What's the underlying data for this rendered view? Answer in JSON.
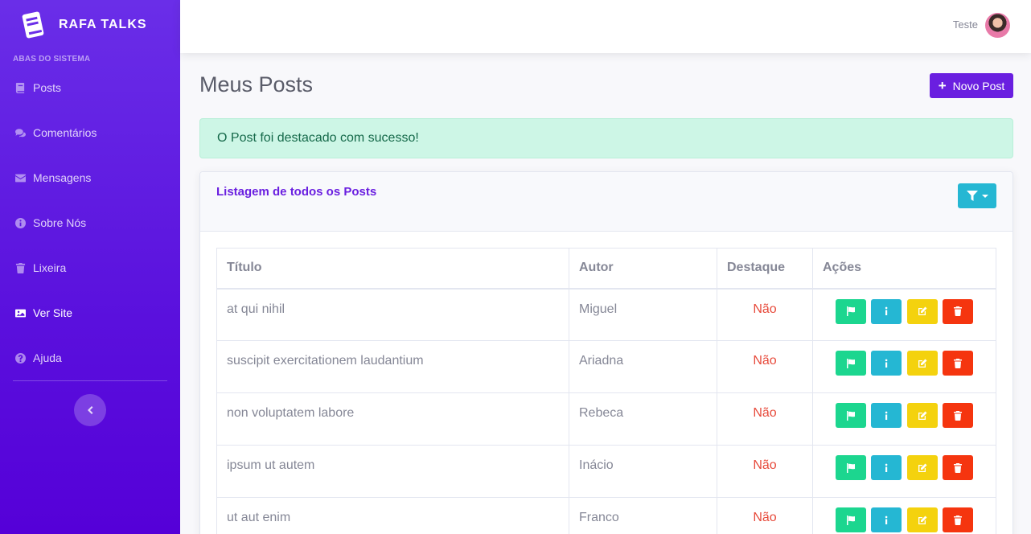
{
  "brand": {
    "name": "RAFA TALKS",
    "logo_icon": "book-logo-icon"
  },
  "sidebar": {
    "heading": "ABAS DO SISTEMA",
    "items": [
      {
        "label": "Posts",
        "icon": "book-icon",
        "active": false
      },
      {
        "label": "Comentários",
        "icon": "comments-icon",
        "active": false
      },
      {
        "label": "Mensagens",
        "icon": "envelope-icon",
        "active": false
      },
      {
        "label": "Sobre Nós",
        "icon": "info-circle-icon",
        "active": false
      },
      {
        "label": "Lixeira",
        "icon": "trash-icon",
        "active": false
      },
      {
        "label": "Ver Site",
        "icon": "image-icon",
        "active": true
      },
      {
        "label": "Ajuda",
        "icon": "question-circle-icon",
        "active": false
      }
    ],
    "toggle_icon": "chevron-left-icon"
  },
  "topbar": {
    "user_name": "Teste"
  },
  "main": {
    "title": "Meus Posts",
    "new_post_label": "Novo Post",
    "alert": "O Post foi destacado com sucesso!",
    "card_title": "Listagem de todos os Posts",
    "filter_icon": "filter-icon",
    "table": {
      "headers": [
        "Título",
        "Autor",
        "Destaque",
        "Ações"
      ],
      "rows": [
        {
          "title": "at qui nihil",
          "author": "Miguel",
          "featured": "Não"
        },
        {
          "title": "suscipit exercitationem laudantium",
          "author": "Ariadna",
          "featured": "Não"
        },
        {
          "title": "non voluptatem labore",
          "author": "Rebeca",
          "featured": "Não"
        },
        {
          "title": "ipsum ut autem",
          "author": "Inácio",
          "featured": "Não"
        },
        {
          "title": "ut aut enim",
          "author": "Franco",
          "featured": "Não"
        }
      ]
    }
  },
  "colors": {
    "primary": "#6a1fe0",
    "success_button": "#1cd68f",
    "info_button": "#25b7d3",
    "warning_button": "#f4d20e",
    "danger_button": "#f5350f",
    "status_text": "#e74a3b",
    "alert_bg": "#cdf6e6"
  }
}
